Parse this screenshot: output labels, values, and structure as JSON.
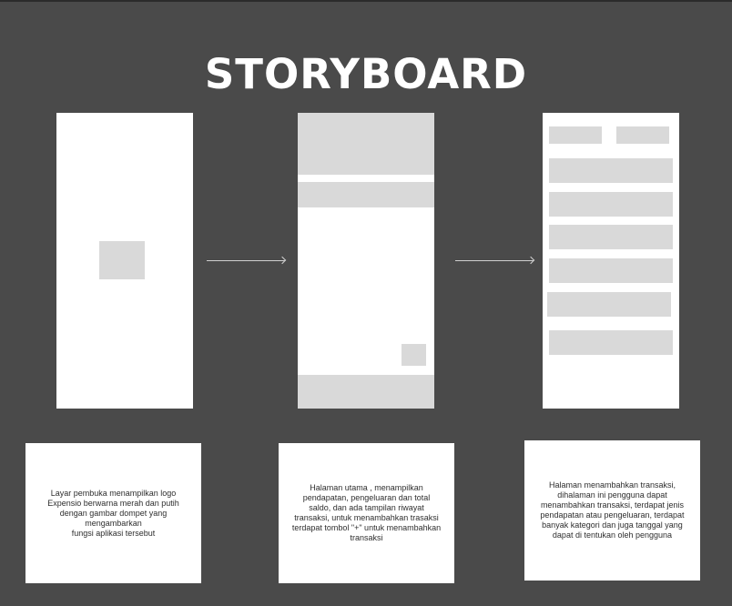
{
  "title": "STORYBOARD",
  "descriptions": [
    "Layar pembuka menampilkan logo\nExpensio berwarna merah dan putih\ndengan gambar dompet yang\nmengambarkan\nfungsi aplikasi tersebut",
    "Halaman utama , menampilkan\npendapatan, pengeluaran dan total\nsaldo, dan ada tampilan riwayat\ntransaksi, untuk menambahkan trasaksi\nterdapat tombol \"+\" untuk menambahkan\ntransaksi",
    "Halaman menambahkan transaksi,\ndihalaman ini pengguna dapat\nmenambahkan transaksi, terdapat jenis\npendapatan atau pengeluaran, terdapat\nbanyak kategori dan juga tanggal yang\ndapat di tentukan oleh pengguna"
  ]
}
